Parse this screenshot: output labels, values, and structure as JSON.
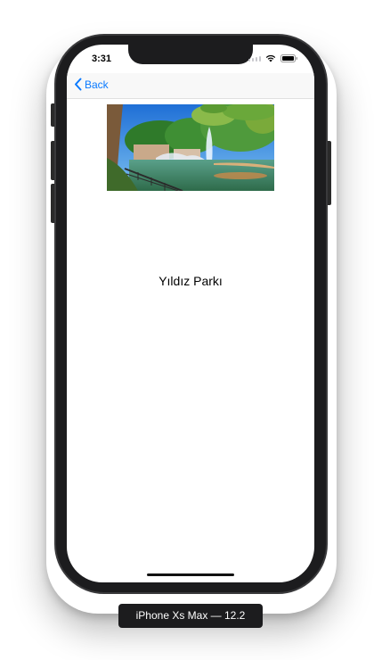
{
  "status_bar": {
    "time": "3:31"
  },
  "nav": {
    "back_label": "Back"
  },
  "content": {
    "title": "Yıldız Parkı"
  },
  "simulator": {
    "device_label": "iPhone Xs Max — 12.2"
  },
  "colors": {
    "accent": "#0a7aff",
    "device_frame": "#1c1c1e"
  }
}
